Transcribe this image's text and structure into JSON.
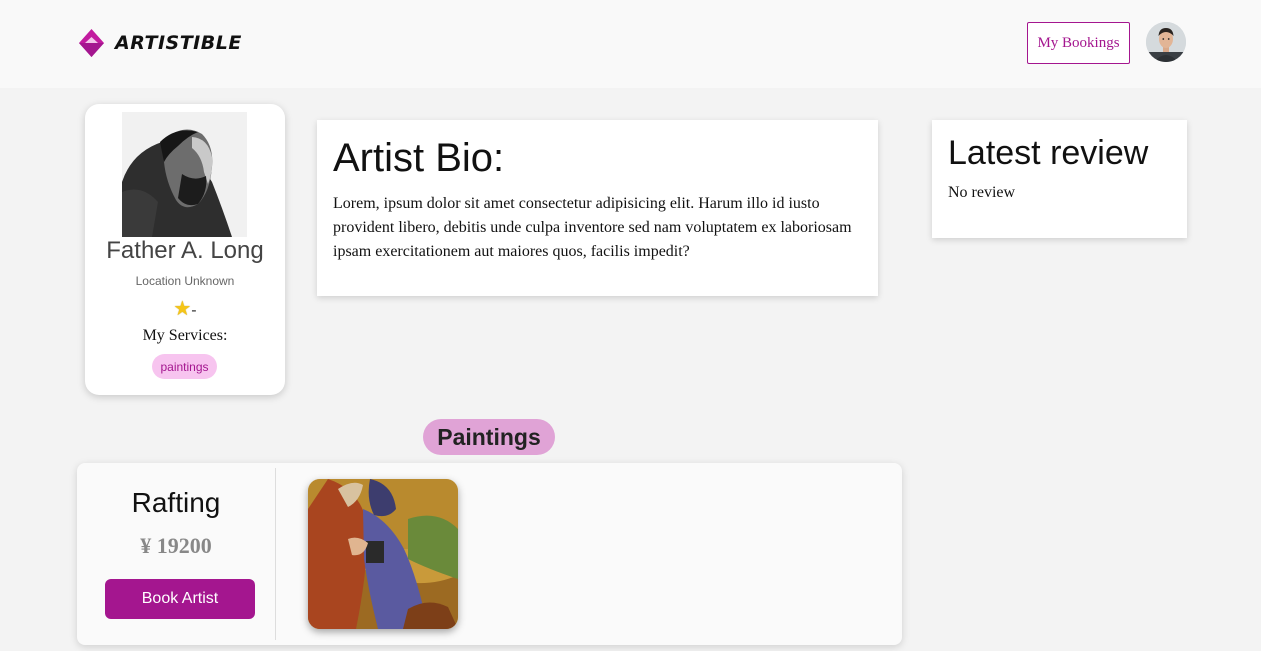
{
  "header": {
    "logo_text": "ARTISTIBLE",
    "bookings_label": "My Bookings",
    "accent_color": "#a4168f"
  },
  "profile": {
    "name": "Father A. Long",
    "location": "Location Unknown",
    "rating_suffix": "-",
    "services_title": "My Services:",
    "services": [
      "paintings"
    ]
  },
  "bio": {
    "title": "Artist Bio:",
    "text": "Lorem, ipsum dolor sit amet consectetur adipisicing elit. Harum illo id iusto provident libero, debitis unde culpa inventore sed nam voluptatem ex laboriosam ipsam exercitationem aut maiores quos, facilis impedit?"
  },
  "review": {
    "title": "Latest review",
    "text": "No review"
  },
  "category": {
    "label": "Paintings"
  },
  "service_item": {
    "name": "Rafting",
    "price": "¥ 19200",
    "book_label": "Book Artist"
  }
}
